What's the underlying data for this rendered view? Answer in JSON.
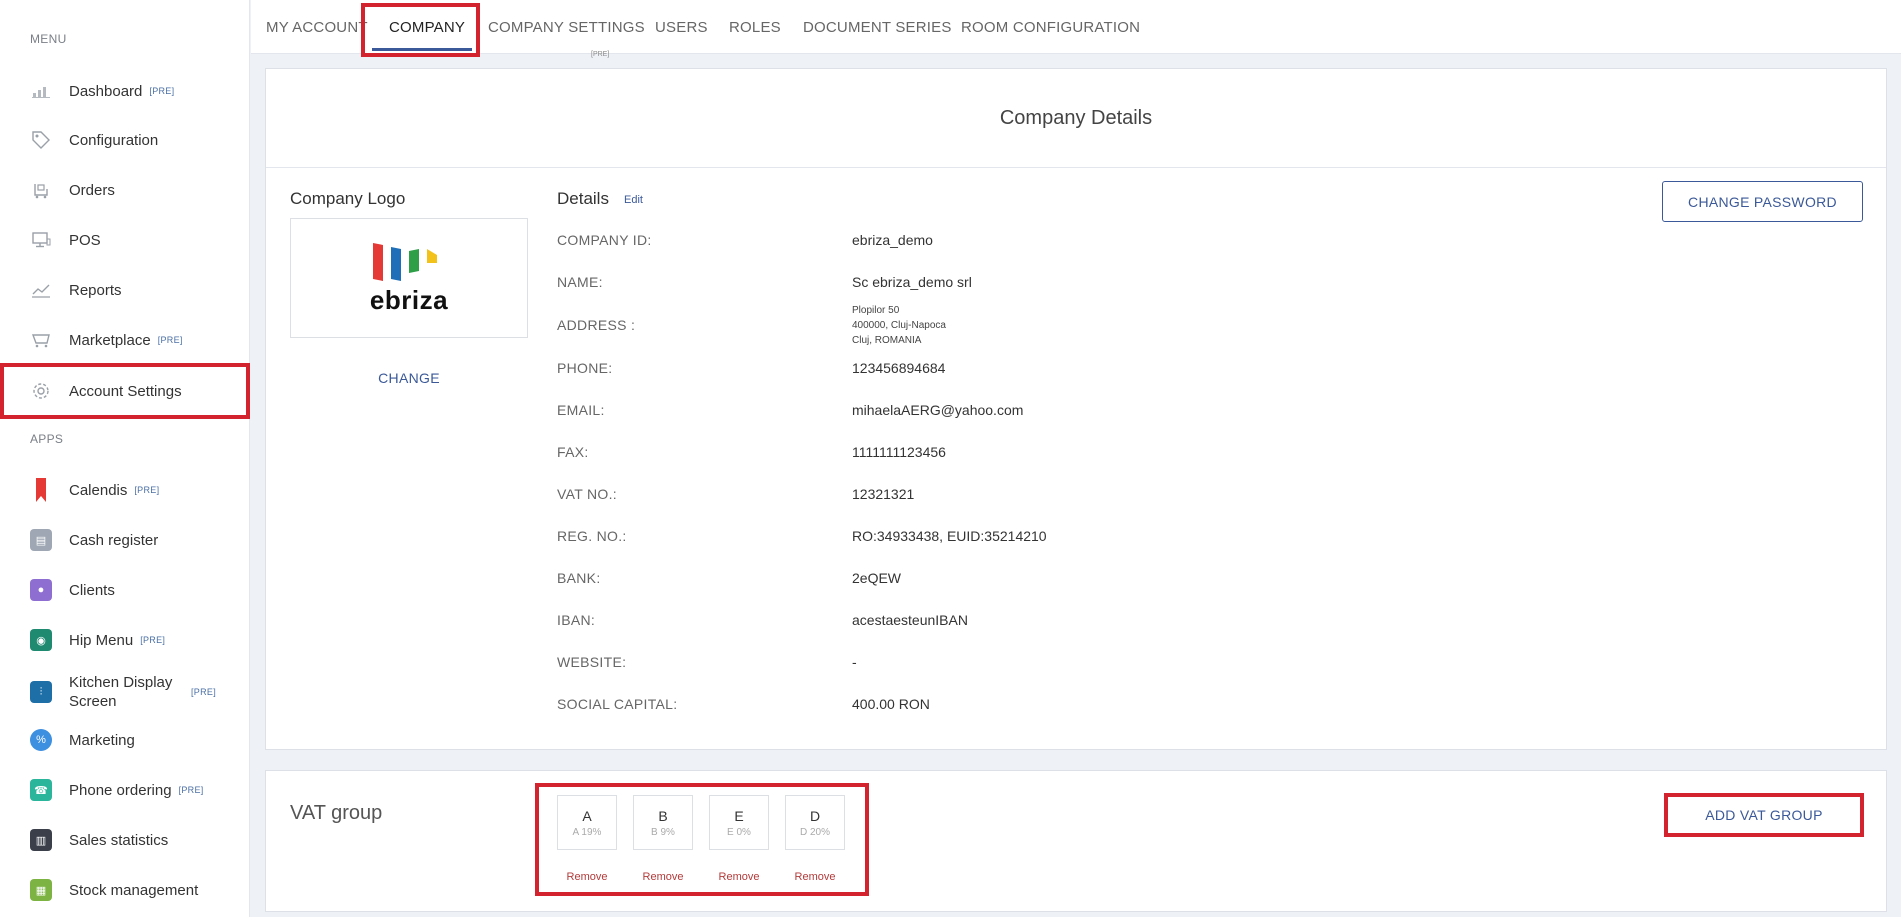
{
  "sidebar": {
    "menu_label": "MENU",
    "apps_label": "APPS",
    "pre_badge": "[PRE]",
    "menu_items": [
      {
        "label": "Dashboard",
        "pre": true,
        "icon": "bar-chart-icon"
      },
      {
        "label": "Configuration",
        "pre": false,
        "icon": "tag-icon"
      },
      {
        "label": "Orders",
        "pre": false,
        "icon": "cart-icon"
      },
      {
        "label": "POS",
        "pre": false,
        "icon": "monitor-icon"
      },
      {
        "label": "Reports",
        "pre": false,
        "icon": "line-chart-icon"
      },
      {
        "label": "Marketplace",
        "pre": true,
        "icon": "basket-icon"
      },
      {
        "label": "Account Settings",
        "pre": false,
        "icon": "gear-icon"
      }
    ],
    "app_items": [
      {
        "label": "Calendis",
        "pre": true,
        "icon": "bookmark-icon",
        "color": "#e53935"
      },
      {
        "label": "Cash register",
        "pre": false,
        "icon": "register-icon",
        "color": "#9ea7b3"
      },
      {
        "label": "Clients",
        "pre": false,
        "icon": "people-icon",
        "color": "#8e6fd1"
      },
      {
        "label": "Hip Menu",
        "pre": true,
        "icon": "hipmenu-icon",
        "color": "#1f8a70"
      },
      {
        "label": "Kitchen Display Screen",
        "label_line1": "Kitchen Display",
        "label_line2": "Screen",
        "pre": true,
        "icon": "cutlery-icon",
        "color": "#1e6fa8"
      },
      {
        "label": "Marketing",
        "pre": false,
        "icon": "percent-icon",
        "color": "#3d8fe0"
      },
      {
        "label": "Phone ordering",
        "pre": true,
        "icon": "phone-icon",
        "color": "#2bb59a"
      },
      {
        "label": "Sales statistics",
        "pre": false,
        "icon": "stats-icon",
        "color": "#3a3f4a"
      },
      {
        "label": "Stock management",
        "pre": false,
        "icon": "stock-icon",
        "color": "#7cb342"
      }
    ]
  },
  "tabs": {
    "items": [
      "MY ACCOUNT",
      "COMPANY",
      "COMPANY SETTINGS",
      "USERS",
      "ROLES",
      "DOCUMENT SERIES",
      "ROOM CONFIGURATION"
    ],
    "active": "COMPANY",
    "my_account_badge": "[PRE]"
  },
  "company": {
    "panel_title": "Company Details",
    "logo_heading": "Company Logo",
    "logo_text": "ebriza",
    "change_label": "CHANGE",
    "details_heading": "Details",
    "edit_label": "Edit",
    "change_password_label": "CHANGE PASSWORD",
    "fields": [
      {
        "label": "COMPANY ID:",
        "value": "ebriza_demo"
      },
      {
        "label": "NAME:",
        "value": "Sc ebriza_demo srl"
      },
      {
        "label": "ADDRESS :",
        "lines": [
          "Plopilor 50",
          "400000, Cluj-Napoca",
          "Cluj, ROMANIA"
        ]
      },
      {
        "label": "PHONE:",
        "value": "123456894684"
      },
      {
        "label": "EMAIL:",
        "value": "mihaelaAERG@yahoo.com"
      },
      {
        "label": "FAX:",
        "value": "1111111123456"
      },
      {
        "label": "VAT NO.:",
        "value": "12321321"
      },
      {
        "label": "REG. NO.:",
        "value": "RO:34933438, EUID:35214210"
      },
      {
        "label": "BANK:",
        "value": "2eQEW"
      },
      {
        "label": "IBAN:",
        "value": "acestaesteunIBAN"
      },
      {
        "label": "WEBSITE:",
        "value": "-"
      },
      {
        "label": "SOCIAL CAPITAL:",
        "value": "400.00 RON"
      }
    ]
  },
  "vat": {
    "title": "VAT group",
    "add_label": "ADD VAT GROUP",
    "remove_label": "Remove",
    "groups": [
      {
        "code": "A",
        "sub": "A 19%"
      },
      {
        "code": "B",
        "sub": "B 9%"
      },
      {
        "code": "E",
        "sub": "E 0%"
      },
      {
        "code": "D",
        "sub": "D 20%"
      }
    ]
  },
  "colors": {
    "accent": "#3b5998",
    "highlight": "#d3232e",
    "remove": "#b33a3a"
  }
}
